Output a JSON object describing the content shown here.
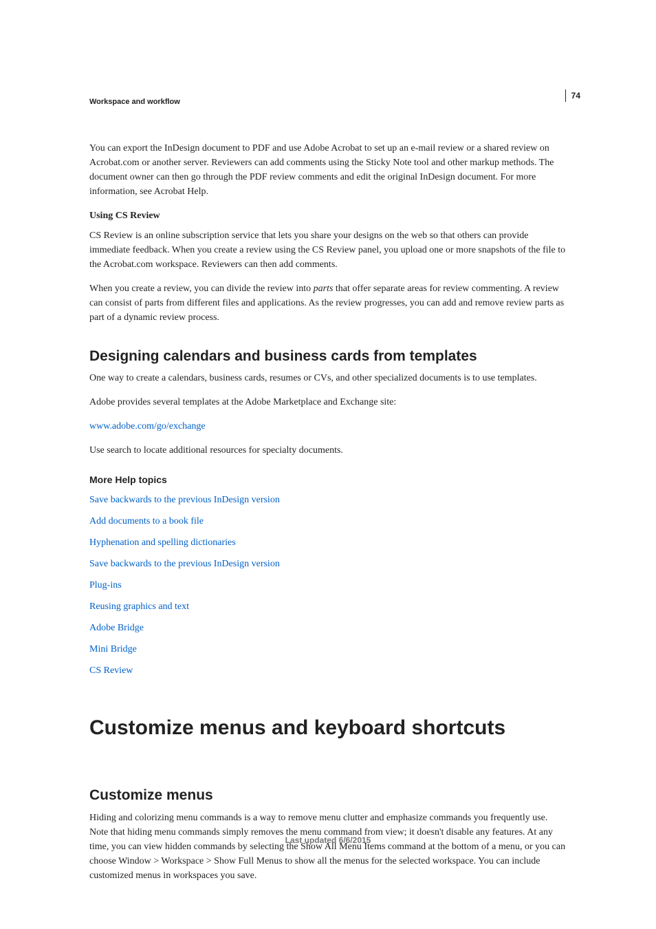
{
  "page_number": "74",
  "breadcrumb": "Workspace and workflow",
  "intro_para": "You can export the InDesign document to PDF and use Adobe Acrobat to set up an e-mail review or a shared review on Acrobat.com or another server. Reviewers can add comments using the Sticky Note tool and other markup methods. The document owner can then go through the PDF review comments and edit the original InDesign document. For more information, see Acrobat Help.",
  "sub1_title": "Using CS Review",
  "sub1_p1": "CS Review is an online subscription service that lets you share your designs on the web so that others can provide immediate feedback. When you create a review using the CS Review panel, you upload one or more snapshots of the file to the Acrobat.com workspace. Reviewers can then add comments.",
  "sub1_p2_pre": "When you create a review, you can divide the review into ",
  "sub1_p2_em": "parts",
  "sub1_p2_post": " that offer separate areas for review commenting. A review can consist of parts from different files and applications. As the review progresses, you can add and remove review parts as part of a dynamic review process.",
  "section2_title": "Designing calendars and business cards from templates",
  "section2_p1": "One way to create a calendars, business cards, resumes or CVs, and other specialized documents is to use templates.",
  "section2_p2": "Adobe provides several templates at the Adobe Marketplace and Exchange site:",
  "section2_link": "www.adobe.com/go/exchange",
  "section2_p3": "Use search to locate additional resources for specialty documents.",
  "more_help_title": "More Help topics",
  "help_links": [
    "Save backwards to the previous InDesign version",
    "Add documents to a book file",
    "Hyphenation and spelling dictionaries",
    "Save backwards to the previous InDesign version",
    "Plug-ins",
    "Reusing graphics and text",
    "Adobe Bridge",
    "Mini Bridge",
    "CS Review"
  ],
  "chapter_title": "Customize menus and keyboard shortcuts",
  "section3_title": "Customize menus",
  "section3_p1": "Hiding and colorizing menu commands is a way to remove menu clutter and emphasize commands you frequently use. Note that hiding menu commands simply removes the menu command from view; it doesn't disable any features. At any time, you can view hidden commands by selecting the Show All Menu Items command at the bottom of a menu, or you can choose Window > Workspace > Show Full Menus to show all the menus for the selected workspace. You can include customized menus in workspaces you save.",
  "footer": "Last updated 6/6/2015"
}
